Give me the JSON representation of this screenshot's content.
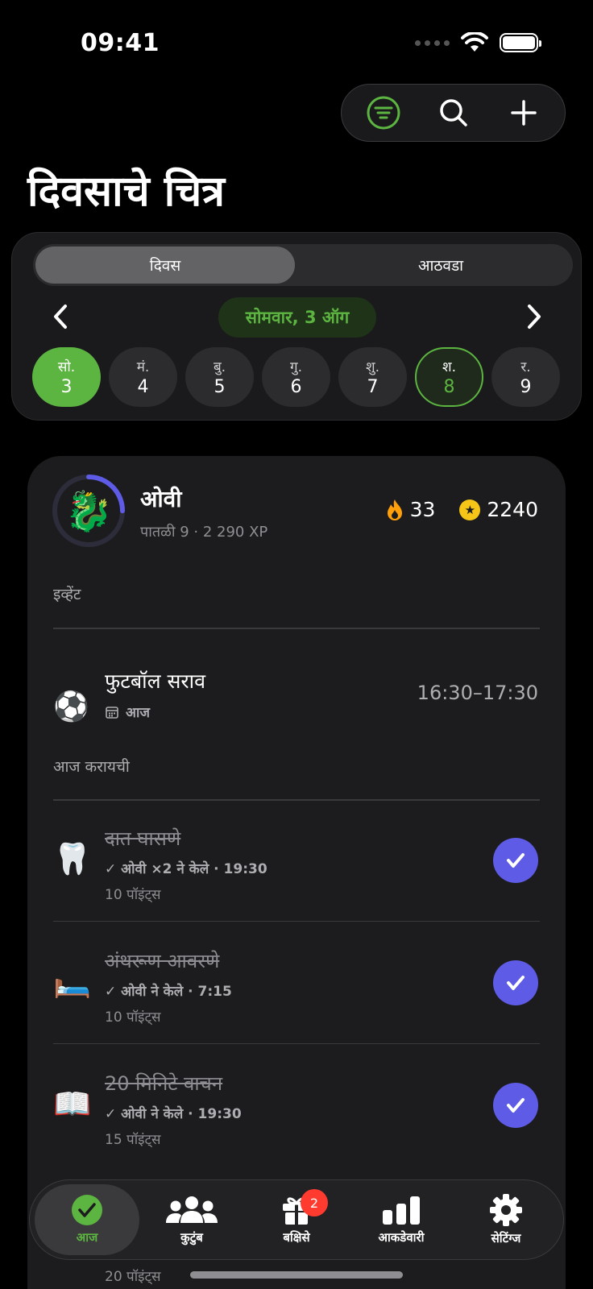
{
  "status": {
    "time": "09:41"
  },
  "title": "दिवसाचे चित्र",
  "view_toggle": {
    "day": "दिवस",
    "week": "आठवडा"
  },
  "date_label": "सोमवार, 3 ऑग",
  "days": [
    {
      "name": "सो.",
      "num": "3"
    },
    {
      "name": "मं.",
      "num": "4"
    },
    {
      "name": "बु.",
      "num": "5"
    },
    {
      "name": "गु.",
      "num": "6"
    },
    {
      "name": "शु.",
      "num": "7"
    },
    {
      "name": "श.",
      "num": "8"
    },
    {
      "name": "र.",
      "num": "9"
    }
  ],
  "profile": {
    "avatar_icon": "dragon-icon",
    "name": "ओवी",
    "level": "पातळी 9 · 2 290 XP",
    "level_progress": 0.25,
    "streak": "33",
    "coins": "2240"
  },
  "events_label": "इव्हेंट",
  "event": {
    "icon": "soccer-ball-icon",
    "title": "फुटबॉल सराव",
    "sub": "आज",
    "time": "16:30–17:30"
  },
  "todo_label": "आज करायची",
  "tasks": [
    {
      "icon": "tooth-icon",
      "title": "दात घासणे",
      "done": "✓ ओवी ×2 ने केले · 19:30",
      "points": "10 पॉइंट्स"
    },
    {
      "icon": "bed-icon",
      "title": "अंथरूण आवरणे",
      "done": "✓ ओवी ने केले · 7:15",
      "points": "10 पॉइंट्स"
    },
    {
      "icon": "book-icon",
      "title": "20 मिनिटे वाचन",
      "done": "✓ ओवी ने केले · 19:30",
      "points": "15 पॉइंट्स"
    }
  ],
  "peek_points": "20 पॉइंट्स",
  "tabs": {
    "today": "आज",
    "family": "कुटुंब",
    "rewards": "बक्षिसे",
    "rewards_badge": "2",
    "stats": "आकडेवारी",
    "settings": "सेटिंग्ज"
  },
  "colors": {
    "accent_green": "#5cb541",
    "accent_purple": "#5e5ce6",
    "badge_red": "#ff3b30"
  }
}
